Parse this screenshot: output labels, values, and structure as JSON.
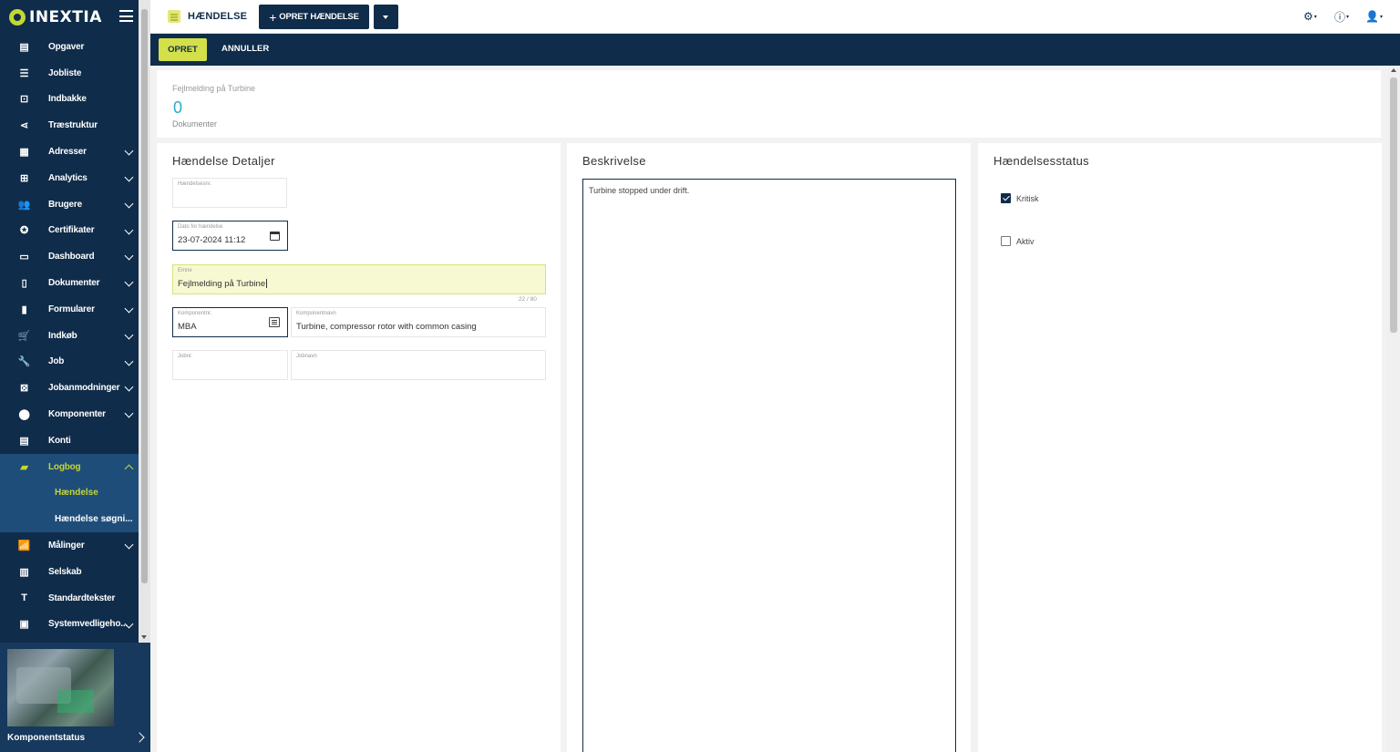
{
  "app": {
    "logo": "INEXTIA",
    "brand_color": "#0f2c4a",
    "accent_color": "#c5d630"
  },
  "sidebar": {
    "items": [
      {
        "label": "Opgaver",
        "icon": "inbox-list-icon"
      },
      {
        "label": "Jobliste",
        "icon": "checklist-icon"
      },
      {
        "label": "Indbakke",
        "icon": "download-box-icon"
      },
      {
        "label": "Træstruktur",
        "icon": "share-tree-icon"
      },
      {
        "label": "Adresser",
        "icon": "address-book-icon"
      },
      {
        "label": "Analytics",
        "icon": "analytics-icon"
      },
      {
        "label": "Brugere",
        "icon": "users-icon"
      },
      {
        "label": "Certifikater",
        "icon": "certificate-icon"
      },
      {
        "label": "Dashboard",
        "icon": "dashboard-icon"
      },
      {
        "label": "Dokumenter",
        "icon": "document-icon"
      },
      {
        "label": "Formularer",
        "icon": "form-icon"
      },
      {
        "label": "Indkøb",
        "icon": "cart-icon"
      },
      {
        "label": "Job",
        "icon": "wrench-icon"
      },
      {
        "label": "Jobanmodninger",
        "icon": "request-icon"
      },
      {
        "label": "Komponenter",
        "icon": "component-icon"
      },
      {
        "label": "Konti",
        "icon": "accounts-icon"
      },
      {
        "label": "Logbog",
        "icon": "logbook-icon"
      },
      {
        "label": "Målinger",
        "icon": "measurements-icon"
      },
      {
        "label": "Selskab",
        "icon": "company-icon"
      },
      {
        "label": "Standardtekster",
        "icon": "text-icon"
      },
      {
        "label": "Systemvedligeho...",
        "icon": "system-maintenance-icon"
      }
    ],
    "sub_items": [
      {
        "label": "Hændelse"
      },
      {
        "label": "Hændelse søgni..."
      }
    ],
    "card": {
      "caption": "Komponentstatus"
    }
  },
  "topbar": {
    "title": "HÆNDELSE",
    "create_button": "OPRET HÆNDELSE",
    "icons": [
      "settings-icon",
      "help-icon",
      "user-icon"
    ]
  },
  "actionbar": {
    "create": "OPRET",
    "cancel": "ANNULLER"
  },
  "summary": {
    "subject": "Fejlmelding på Turbine",
    "count": "0",
    "count_label": "Dokumenter"
  },
  "details": {
    "heading": "Hændelse Detaljer",
    "event_no": {
      "label": "Hændelsesnr.",
      "value": ""
    },
    "date": {
      "label": "Dato for hændelse",
      "value": "23-07-2024 11:12"
    },
    "subject": {
      "label": "Emne",
      "value": "Fejlmelding på Turbine",
      "counter": "22 / 80"
    },
    "component_no": {
      "label": "Komponentnr.",
      "value": "MBA"
    },
    "component_name": {
      "label": "Komponentnavn",
      "value": "Turbine, compressor rotor with common casing"
    },
    "job_no": {
      "label": "Jobnr.",
      "value": ""
    },
    "job_name": {
      "label": "Jobnavn",
      "value": ""
    }
  },
  "description": {
    "heading": "Beskrivelse",
    "text": "Turbine stopped under drift."
  },
  "status": {
    "heading": "Hændelsesstatus",
    "critical": {
      "label": "Kritisk",
      "checked": true
    },
    "active": {
      "label": "Aktiv",
      "checked": false
    }
  }
}
